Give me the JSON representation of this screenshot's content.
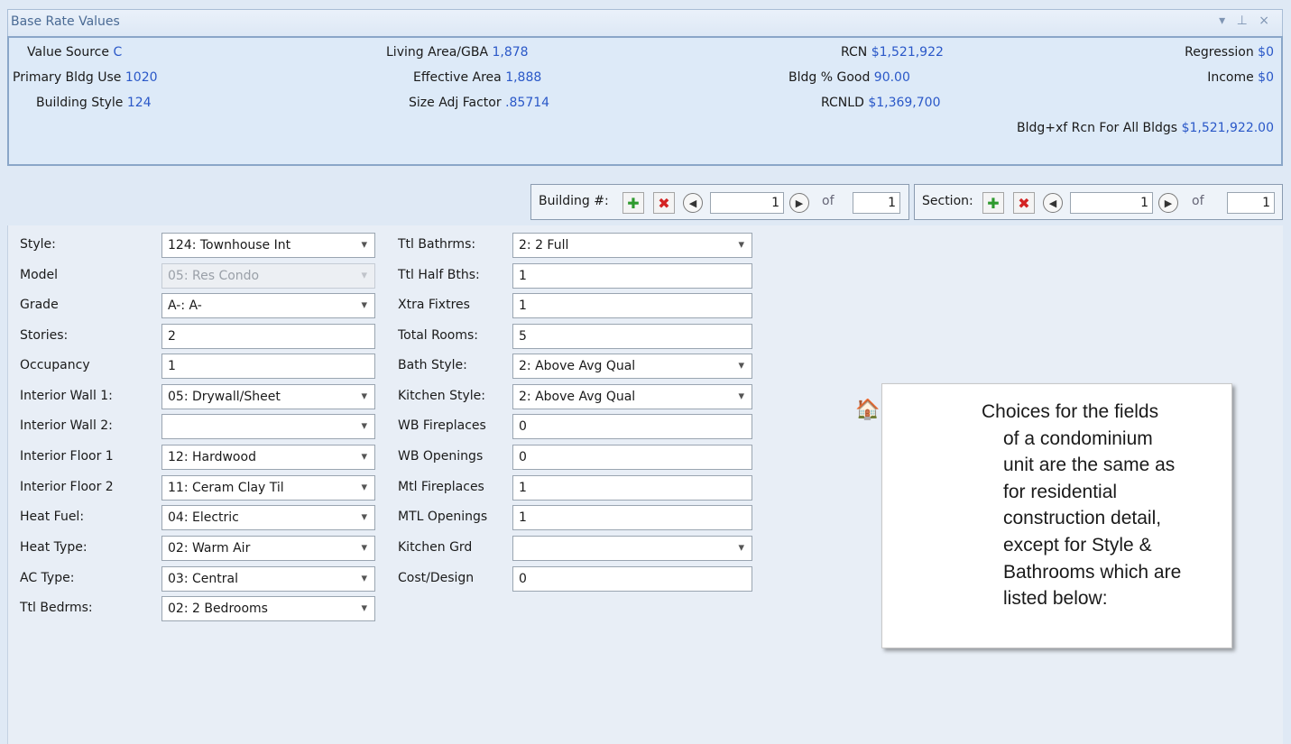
{
  "pane": {
    "title": "Base Rate Values",
    "controls": "▾ ⊓ ×"
  },
  "summary": {
    "value_source": {
      "label": "Value Source",
      "value": "C"
    },
    "primary_bldg_use": {
      "label": "Primary Bldg Use",
      "value": "1020"
    },
    "building_style": {
      "label": "Building Style",
      "value": "124"
    },
    "living_area": {
      "label": "Living Area/GBA",
      "value": "1,878"
    },
    "effective_area": {
      "label": "Effective Area",
      "value": "1,888"
    },
    "size_adj_factor": {
      "label": "Size Adj Factor",
      "value": ".85714"
    },
    "rcn": {
      "label": "RCN",
      "value": "$1,521,922"
    },
    "bldg_pct_good": {
      "label": "Bldg % Good",
      "value": "90.00"
    },
    "rcnld": {
      "label": "RCNLD",
      "value": "$1,369,700"
    },
    "regression": {
      "label": "Regression",
      "value": "$0"
    },
    "income": {
      "label": "Income",
      "value": "$0"
    },
    "bldg_xf_rcn": {
      "label": "Bldg+xf Rcn For All Bldgs",
      "value": "$1,521,922.00"
    }
  },
  "building_nav": {
    "label": "Building #:",
    "current": "1",
    "of_label": "of",
    "total": "1"
  },
  "section_nav": {
    "label": "Section:",
    "current": "1",
    "of_label": "of",
    "total": "1"
  },
  "left_fields": [
    {
      "label": "Style:",
      "value": "124: Townhouse Int"
    },
    {
      "label": "Model",
      "value": "05: Res Condo"
    },
    {
      "label": "Grade",
      "value": "A-: A-"
    },
    {
      "label": "Stories:",
      "value": "2"
    },
    {
      "label": "Occupancy",
      "value": "1"
    },
    {
      "label": "Interior Wall 1:",
      "value": "05: Drywall/Sheet"
    },
    {
      "label": "Interior Wall 2:",
      "value": ""
    },
    {
      "label": "Interior Floor 1",
      "value": "12: Hardwood"
    },
    {
      "label": "Interior Floor 2",
      "value": "11: Ceram Clay Til"
    },
    {
      "label": "Heat Fuel:",
      "value": "04: Electric"
    },
    {
      "label": "Heat Type:",
      "value": "02: Warm Air"
    },
    {
      "label": "AC Type:",
      "value": "03: Central"
    },
    {
      "label": "Ttl Bedrms:",
      "value": "02: 2 Bedrooms"
    }
  ],
  "right_fields": [
    {
      "label": "Ttl Bathrms:",
      "value": "2: 2 Full"
    },
    {
      "label": "Ttl Half Bths:",
      "value": "1"
    },
    {
      "label": "Xtra Fixtres",
      "value": "1"
    },
    {
      "label": "Total Rooms:",
      "value": "5"
    },
    {
      "label": "Bath Style:",
      "value": "2: Above Avg Qual"
    },
    {
      "label": "Kitchen Style:",
      "value": "2: Above Avg Qual"
    },
    {
      "label": "WB Fireplaces",
      "value": "0"
    },
    {
      "label": "WB Openings",
      "value": "0"
    },
    {
      "label": "Mtl Fireplaces",
      "value": "1"
    },
    {
      "label": "MTL Openings",
      "value": "1"
    },
    {
      "label": "Kitchen Grd",
      "value": ""
    },
    {
      "label": "Cost/Design",
      "value": "0"
    }
  ],
  "callout": {
    "icon": "house-note-icon",
    "lines": [
      "Choices for the fields",
      "of a condominium",
      "unit are the same as",
      "for residential",
      "construction detail,",
      "except for Style &",
      "Bathrooms which are",
      "listed below:"
    ]
  }
}
